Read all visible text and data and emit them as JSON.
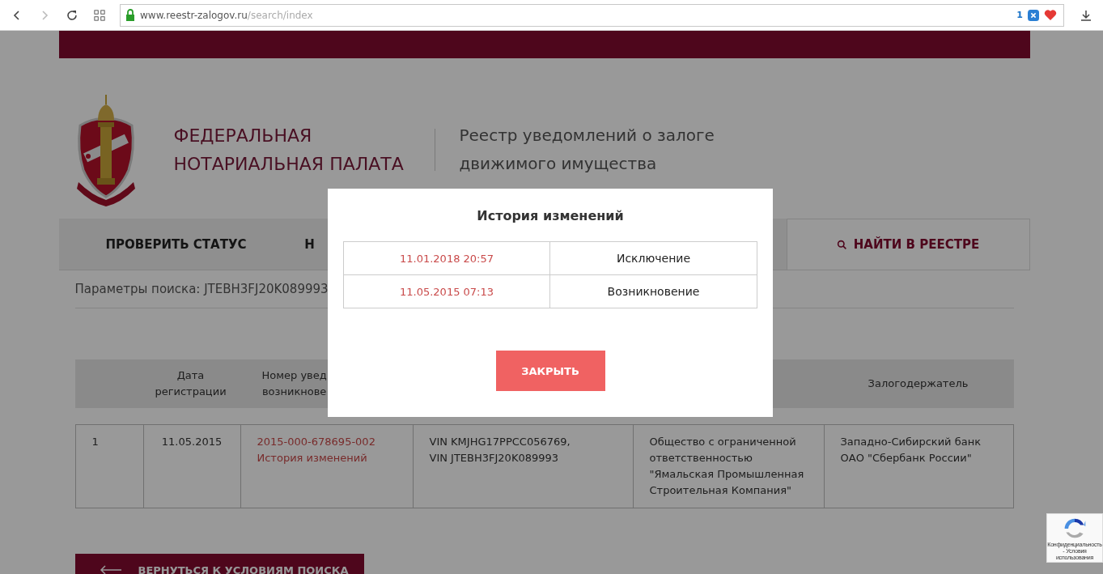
{
  "browser": {
    "url_host": "www.reestr-zalogov.ru",
    "url_path": "/search/index",
    "extension_badge": "1"
  },
  "header": {
    "org_name": [
      "ФЕДЕРАЛЬНАЯ",
      "НОТАРИАЛЬНАЯ ПАЛАТА"
    ],
    "subtitle": [
      "Реестр уведомлений о залоге",
      "движимого имущества"
    ]
  },
  "tabs": [
    {
      "label": "ПРОВЕРИТЬ СТАТУС",
      "selected": false
    },
    {
      "label": "Н",
      "selected": false
    },
    {
      "label": "НАЙТИ В РЕЕСТРЕ",
      "selected": true
    }
  ],
  "search_params": "Параметры поиска: JTEBH3FJ20K089993",
  "table": {
    "columns": [
      {
        "kind": "blank"
      },
      {
        "kind": "text",
        "lines": [
          "Дата",
          "регистрации"
        ]
      },
      {
        "kind": "text",
        "lines": [
          "Номер увед",
          "возникнове"
        ]
      },
      {
        "kind": "blank"
      },
      {
        "kind": "blank"
      },
      {
        "kind": "text",
        "lines": [
          "Залогодержатель"
        ]
      }
    ],
    "rows": [
      [
        {
          "kind": "text",
          "lines": [
            "1"
          ]
        },
        {
          "kind": "text",
          "lines": [
            "11.05.2015"
          ]
        },
        {
          "kind": "links",
          "lines": [
            "2015-000-678695-002",
            "История изменений"
          ]
        },
        {
          "kind": "text",
          "lines": [
            "VIN KMJHG17PPCC056769,",
            "VIN JTEBH3FJ20K089993"
          ]
        },
        {
          "kind": "text",
          "lines": [
            "Общество с ограниченной",
            "ответственностью",
            "\"Ямальская Промышленная",
            "Строительная Компания\""
          ]
        },
        {
          "kind": "text",
          "lines": [
            "Западно-Сибирский банк",
            "ОАО \"Сбербанк России\""
          ]
        }
      ]
    ]
  },
  "back_button": "ВЕРНУТЬСЯ К УСЛОВИЯМ ПОИСКА",
  "recaptcha": {
    "links": "Конфиденциальность - Условия использования"
  },
  "modal": {
    "title": "История изменений",
    "rows": [
      {
        "date": "11.01.2018 20:57",
        "event": "Исключение"
      },
      {
        "date": "11.05.2015 07:13",
        "event": "Возникновение"
      }
    ],
    "close_button": "ЗАКРЫТЬ"
  }
}
